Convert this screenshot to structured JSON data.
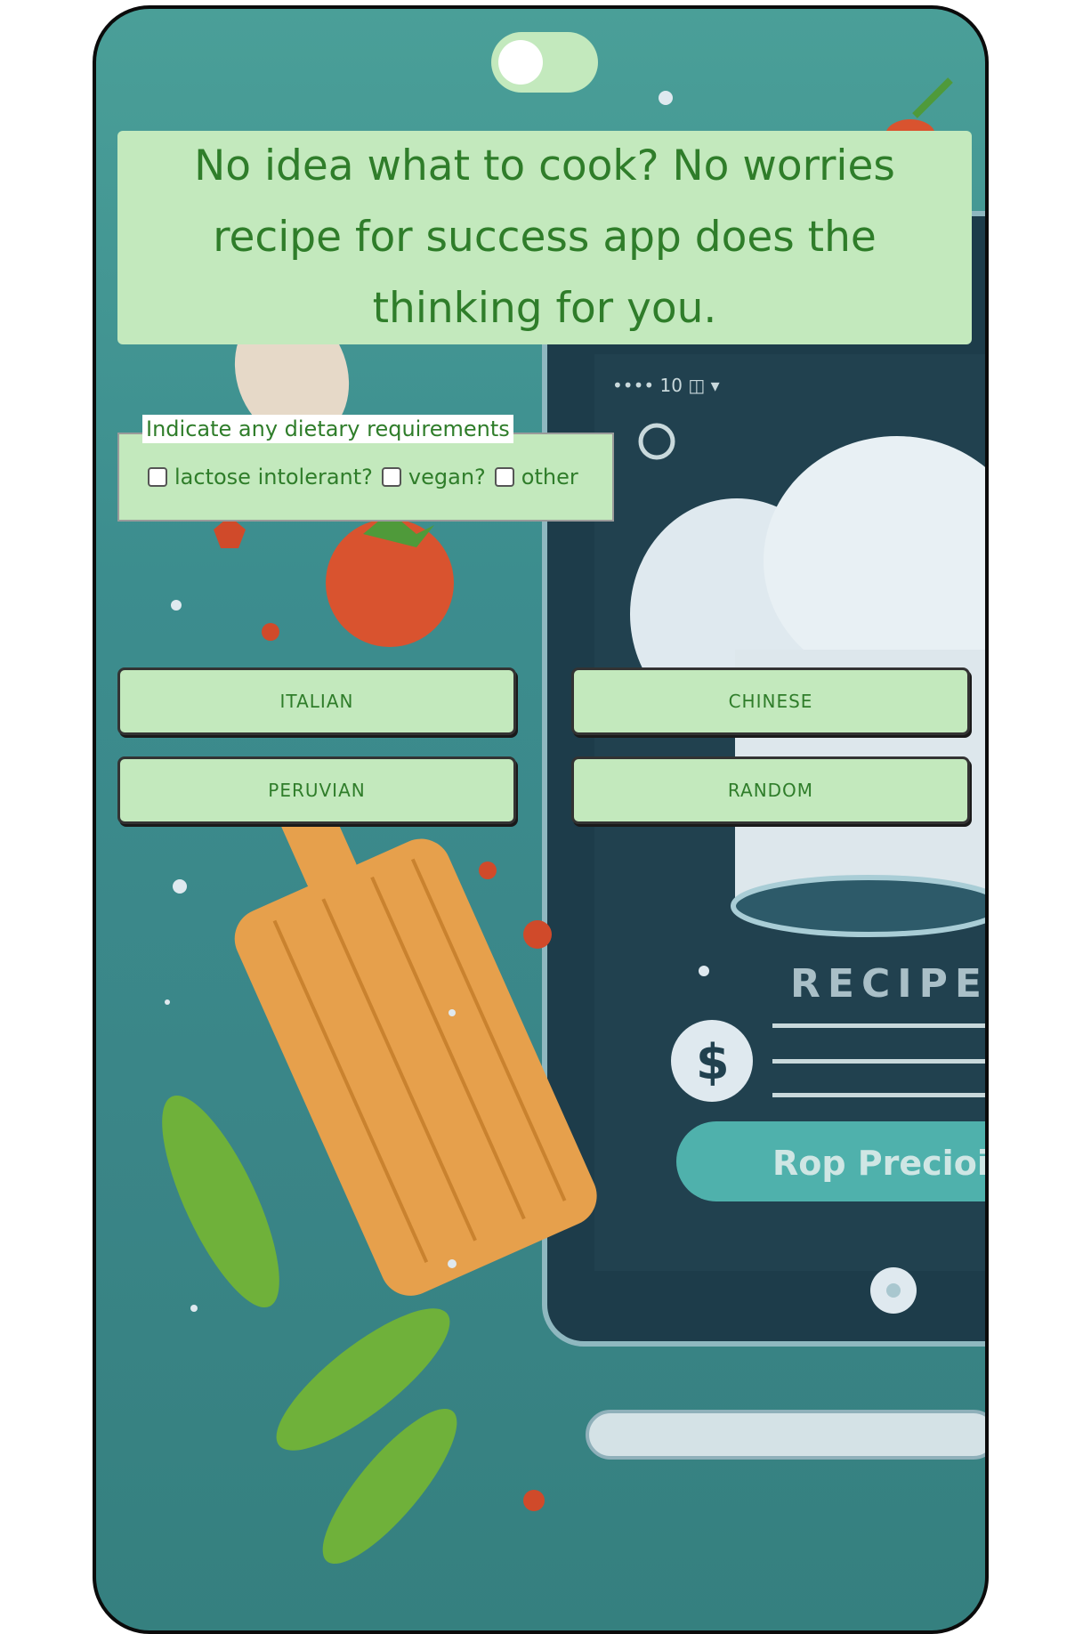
{
  "app": {
    "headline": "No idea what to cook? No worries recipe for success app does the thinking for you."
  },
  "dietary": {
    "legend": "Indicate any dietary requirements",
    "options": [
      "lactose intolerant?",
      "vegan?",
      "other"
    ]
  },
  "cuisines": [
    "ITALIAN",
    "CHINESE",
    "PERUVIAN",
    "RANDOM"
  ],
  "illustration": {
    "recipe_text": "RECIPE",
    "currency_symbol": "$",
    "screen_button_text": "Rop Precioic"
  },
  "colors": {
    "accent_bg": "#c3e9bd",
    "text_green": "#2f7d2a",
    "background_teal": "#4a9f98"
  }
}
